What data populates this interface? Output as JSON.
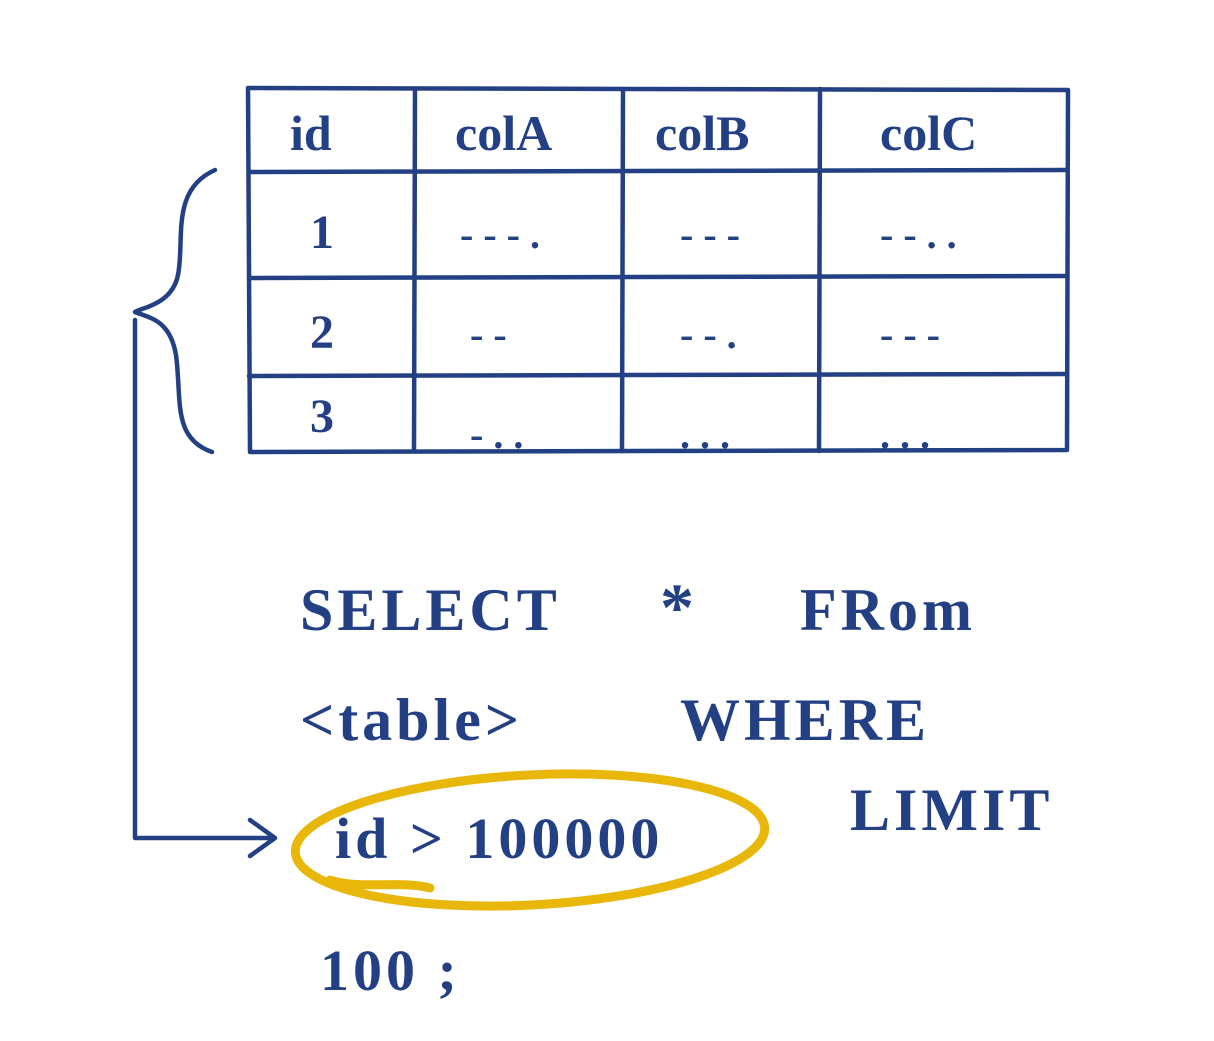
{
  "table": {
    "headers": [
      "id",
      "colA",
      "colB",
      "colC"
    ],
    "rows": [
      {
        "id": "1",
        "a": "- - - .",
        "b": "- - -",
        "c": "- - . ."
      },
      {
        "id": "2",
        "a": "- -",
        "b": "- - .",
        "c": "- - -"
      },
      {
        "id": "3",
        "a": "- . .",
        "b": ". . .",
        "c": ". . ."
      }
    ]
  },
  "sql": {
    "line1a": "SELECT",
    "line1b": "*",
    "line1c": "FRom",
    "line2a": "<table>",
    "line2b": "WHERE",
    "line3a": "id > 100000",
    "line3b": "LIMIT",
    "line4": "100 ;"
  }
}
